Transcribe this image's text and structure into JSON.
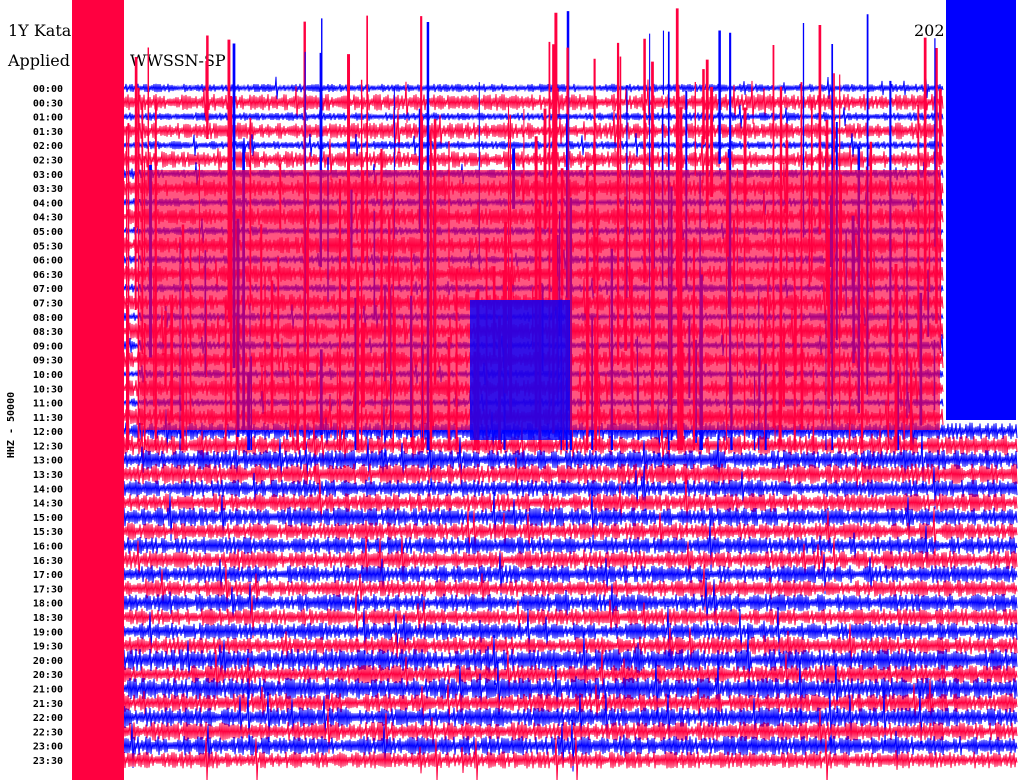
{
  "chart_data": {
    "type": "line",
    "title": "1Y Kata",
    "subtitle_prefix": "Applied",
    "filter": "WWSSN-SP",
    "date_partial": "202",
    "ylabel": "HHZ - 50000",
    "y_tick_labels": [
      "00:00",
      "00:30",
      "01:00",
      "01:30",
      "02:00",
      "02:30",
      "03:00",
      "03:30",
      "04:00",
      "04:30",
      "05:00",
      "05:30",
      "06:00",
      "06:30",
      "07:00",
      "07:30",
      "08:00",
      "08:30",
      "09:00",
      "09:30",
      "10:00",
      "10:30",
      "11:00",
      "11:30",
      "12:00",
      "12:30",
      "13:00",
      "13:30",
      "14:00",
      "14:30",
      "15:00",
      "15:30",
      "16:00",
      "16:30",
      "17:00",
      "17:30",
      "18:00",
      "18:30",
      "19:00",
      "19:30",
      "20:00",
      "20:30",
      "21:00",
      "21:30",
      "22:00",
      "22:30",
      "23:00",
      "23:30"
    ],
    "series_colors": [
      "#0000ff",
      "#ff0040"
    ],
    "grid": false
  }
}
